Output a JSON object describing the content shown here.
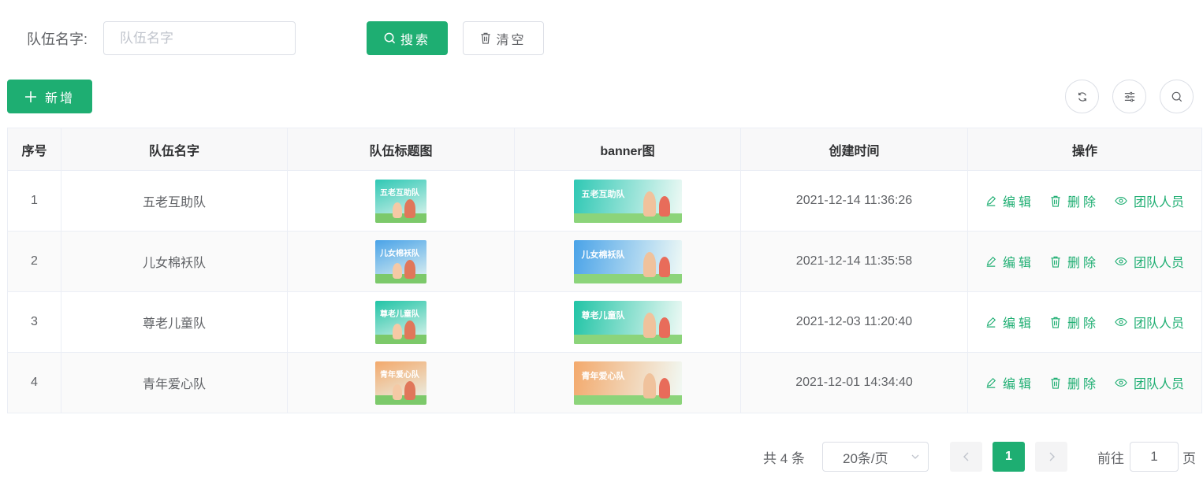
{
  "search": {
    "label": "队伍名字:",
    "placeholder": "队伍名字",
    "value": "",
    "search_label": "搜索",
    "clear_label": "清空"
  },
  "toolbar": {
    "add_label": "新增",
    "icons": [
      "refresh-icon",
      "filter-settings-icon",
      "search-icon"
    ]
  },
  "table": {
    "headers": [
      "序号",
      "队伍名字",
      "队伍标题图",
      "banner图",
      "创建时间",
      "操作"
    ],
    "rows": [
      {
        "index": "1",
        "name": "五老互助队",
        "title_image_text": "五老互助队",
        "banner_text": "五老互助队",
        "created": "2021-12-14 11:36:26",
        "theme": "#2fc8b4"
      },
      {
        "index": "2",
        "name": "儿女棉袄队",
        "title_image_text": "儿女棉袄队",
        "banner_text": "儿女棉袄队",
        "created": "2021-12-14 11:35:58",
        "theme": "#4aa3e8"
      },
      {
        "index": "3",
        "name": "尊老儿童队",
        "title_image_text": "尊老儿童队",
        "banner_text": "尊老儿童队",
        "created": "2021-12-03 11:20:40",
        "theme": "#21c4a6"
      },
      {
        "index": "4",
        "name": "青年爱心队",
        "title_image_text": "青年爱心队",
        "banner_text": "青年爱心队",
        "created": "2021-12-01 14:34:40",
        "theme": "#f3a96c"
      }
    ],
    "actions": {
      "edit": "编辑",
      "delete": "删除",
      "members": "团队人员"
    }
  },
  "pagination": {
    "total": "共 4 条",
    "page_size": "20条/页",
    "current_page": "1",
    "goto_label": "前往",
    "goto_value": "1",
    "page_suffix": "页"
  },
  "colors": {
    "accent": "#1eae72"
  }
}
